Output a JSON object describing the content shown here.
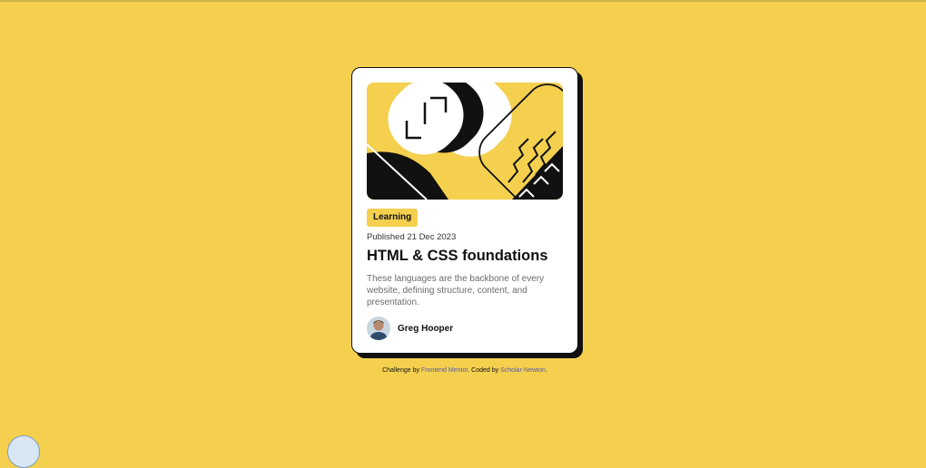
{
  "colors": {
    "background": "#F4D04E",
    "card": "#FFFFFF",
    "ink": "#111111",
    "muted": "#6B6B6B",
    "link": "#5A5AA8"
  },
  "card": {
    "hero_image": "abstract-illustration",
    "badge": "Learning",
    "published": "Published 21 Dec 2023",
    "title": "HTML & CSS foundations",
    "description": "These languages are the backbone of every website, defining structure, content, and presentation.",
    "author": {
      "avatar": "avatar",
      "name": "Greg Hooper"
    }
  },
  "attribution": {
    "prefix": "Challenge by ",
    "challenge_link": "Frontend Mentor",
    "middle": ". Coded by ",
    "author_link": "Scholar-Newton",
    "suffix": "."
  }
}
